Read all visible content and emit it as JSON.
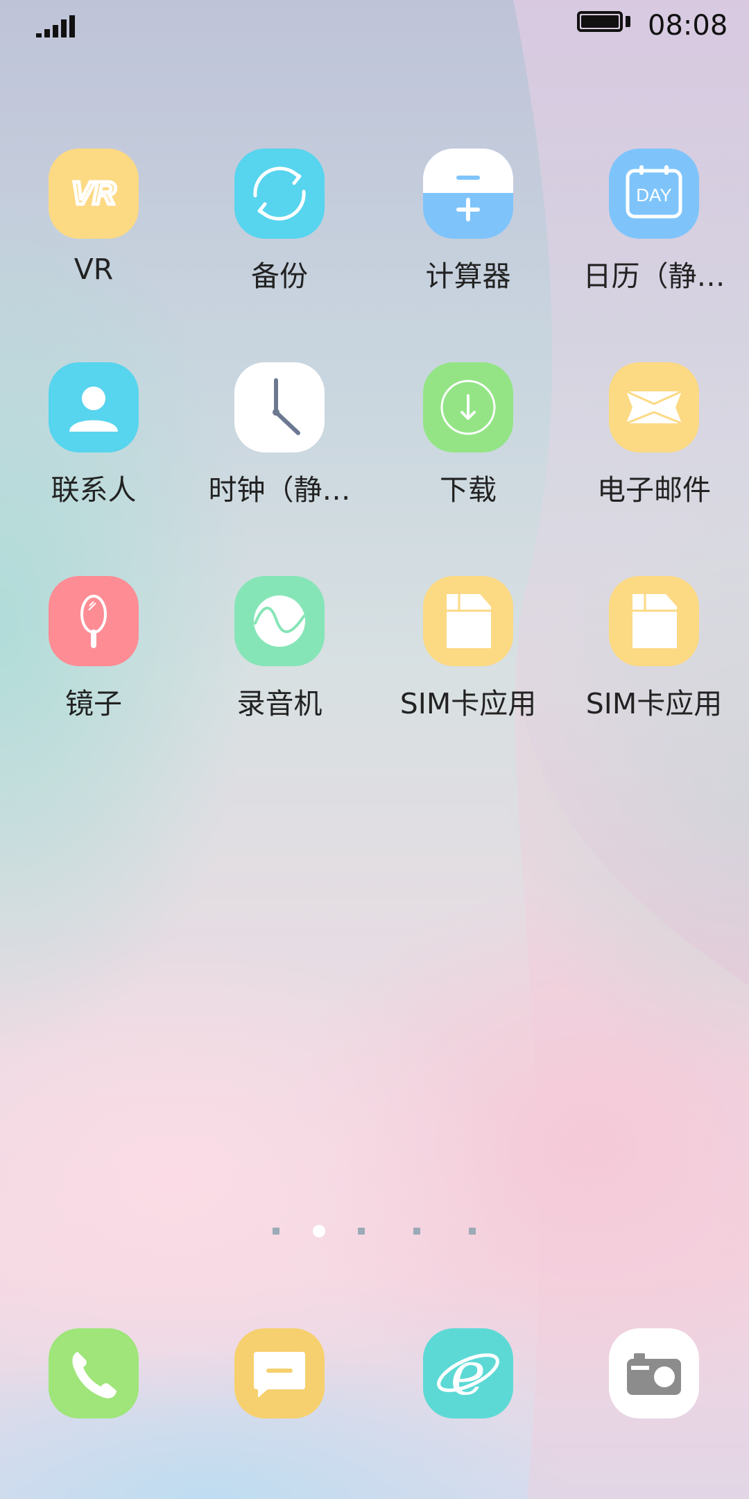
{
  "status_bar": {
    "time": "08:08",
    "signal_icon": "signal-strength-icon",
    "battery_icon": "battery-full-icon"
  },
  "apps": [
    {
      "label": "VR",
      "icon": "vr-icon",
      "color": "#FCD983"
    },
    {
      "label": "备份",
      "icon": "backup-sync-icon",
      "color": "#57D4EE"
    },
    {
      "label": "计算器",
      "icon": "calculator-icon",
      "color": "#7EC4FB"
    },
    {
      "label": "日历（静…",
      "icon": "calendar-day-icon",
      "icon_text": "DAY",
      "color": "#7EC4FB"
    },
    {
      "label": "联系人",
      "icon": "contact-person-icon",
      "color": "#57D4EE"
    },
    {
      "label": "时钟（静…",
      "icon": "clock-icon",
      "color": "#FFFFFF"
    },
    {
      "label": "下载",
      "icon": "download-icon",
      "color": "#94E486"
    },
    {
      "label": "电子邮件",
      "icon": "email-envelope-icon",
      "color": "#FCD983"
    },
    {
      "label": "镜子",
      "icon": "mirror-icon",
      "color": "#FD8C94"
    },
    {
      "label": "录音机",
      "icon": "recorder-wave-icon",
      "color": "#86E5B7"
    },
    {
      "label": "SIM卡应用",
      "icon": "sim-card-icon",
      "color": "#FCD983"
    },
    {
      "label": "SIM卡应用",
      "icon": "sim-card-icon",
      "color": "#FCD983"
    }
  ],
  "page_indicator": {
    "pages": 5,
    "current": 2
  },
  "dock": [
    {
      "name": "phone",
      "icon": "phone-handset-icon",
      "color": "#9FE57A"
    },
    {
      "name": "messages",
      "icon": "message-bubble-icon",
      "color": "#F6D06E"
    },
    {
      "name": "browser",
      "icon": "browser-e-icon",
      "color": "#5DD9D5"
    },
    {
      "name": "camera",
      "icon": "camera-icon",
      "color": "#FFFFFF"
    }
  ]
}
